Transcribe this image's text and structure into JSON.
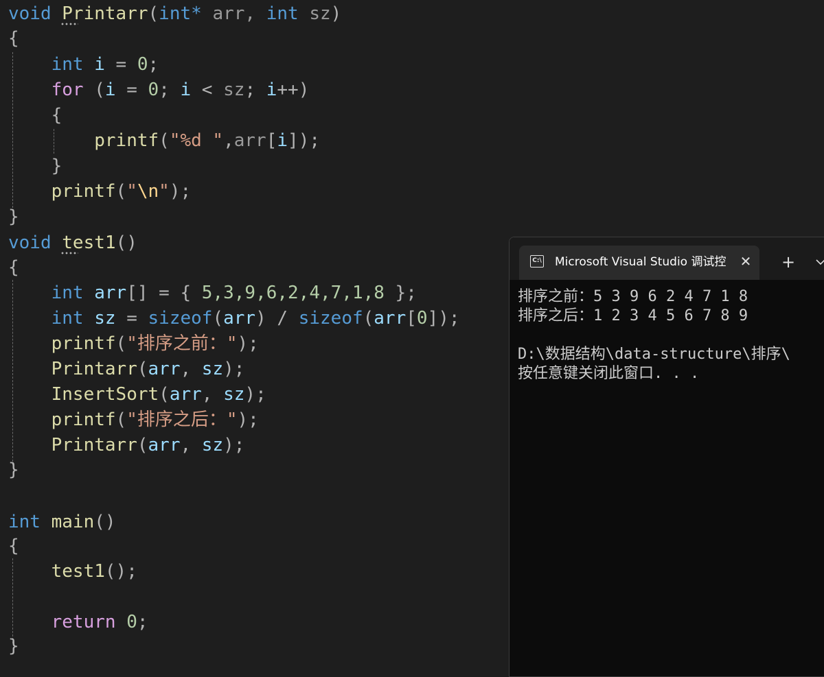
{
  "editor": {
    "printarr_sig": {
      "kw": "void",
      "name": "Printarr",
      "open": "(",
      "type": "int*",
      "p1": " arr, ",
      "type2": "int",
      "p2": " sz",
      "close": ")"
    },
    "open_brace": "{",
    "close_brace": "}",
    "int_i": {
      "kw": "int",
      "rest_var": " i",
      "eq": " = ",
      "num": "0",
      "semi": ";"
    },
    "for_line": {
      "kw": "for",
      "a": " (",
      "i1": "i",
      "eq": " = ",
      "zero": "0",
      "b": "; ",
      "i2": "i",
      "lt": " < ",
      "sz": "sz",
      "c": "; ",
      "i3": "i",
      "inc": "++)",
      "note": ""
    },
    "printf_fmt": {
      "fn": "printf",
      "open": "(",
      "str": "\"%d \"",
      "comma": ",",
      "arr": "arr",
      "br1": "[",
      "i": "i",
      "br2": "]",
      "close": ");"
    },
    "printf_newline": {
      "fn": "printf",
      "open": "(",
      "q1": "\"",
      "esc": "\\n",
      "q2": "\"",
      "close": ");"
    },
    "test1_sig": {
      "kw": "void",
      "name": "test1",
      "paren": "()"
    },
    "arr_decl": {
      "kw": "int",
      "var": " arr",
      "rest": "[] = { ",
      "nums": "5,3,9,6,2,4,7,1,8",
      "end": " };"
    },
    "sz_decl": {
      "kw": "int",
      "var": " sz",
      "eq": " = ",
      "fn1": "sizeof",
      "o1": "(",
      "a1": "arr",
      "c1": ") / ",
      "fn2": "sizeof",
      "o2": "(",
      "a2": "arr",
      "b1": "[",
      "zero": "0",
      "b2": "]",
      "c2": ");"
    },
    "printf_before": {
      "fn": "printf",
      "open": "(",
      "str": "\"排序之前：\"",
      "close": ");"
    },
    "printarr_call1": {
      "fn": "Printarr",
      "open": "(",
      "a": "arr",
      "comma": ", ",
      "b": "sz",
      "close": ");"
    },
    "insertsort_call": {
      "fn": "InsertSort",
      "open": "(",
      "a": "arr",
      "comma": ", ",
      "b": "sz",
      "close": ");"
    },
    "printf_after": {
      "fn": "printf",
      "open": "(",
      "str": "\"排序之后：\"",
      "close": ");"
    },
    "printarr_call2": {
      "fn": "Printarr",
      "open": "(",
      "a": "arr",
      "comma": ", ",
      "b": "sz",
      "close": ");"
    },
    "main_sig": {
      "kw": "int",
      "name": " main",
      "paren": "()"
    },
    "test1_call": {
      "fn": "test1",
      "rest": "();"
    },
    "return_line": {
      "kw": "return",
      "sp": " ",
      "num": "0",
      "semi": ";"
    }
  },
  "console": {
    "tab_title": "Microsoft Visual Studio 调试控",
    "icon": "cmd-icon",
    "close_glyph": "✕",
    "new_tab_glyph": "+",
    "output": [
      "排序之前：5 3 9 6 2 4 7 1 8",
      "排序之后：1 2 3 4 5 6 7 8 9",
      "",
      "D:\\数据结构\\data-structure\\排序\\",
      "按任意键关闭此窗口. . ."
    ]
  },
  "colors": {
    "editor_bg": "#1e1e1e",
    "keyword": "#569cd6",
    "control_keyword": "#d8a0df",
    "function": "#dcdcaa",
    "variable": "#9cdcfe",
    "number": "#b5cea8",
    "string": "#d69d85",
    "console_bg": "#0c0c0c"
  }
}
